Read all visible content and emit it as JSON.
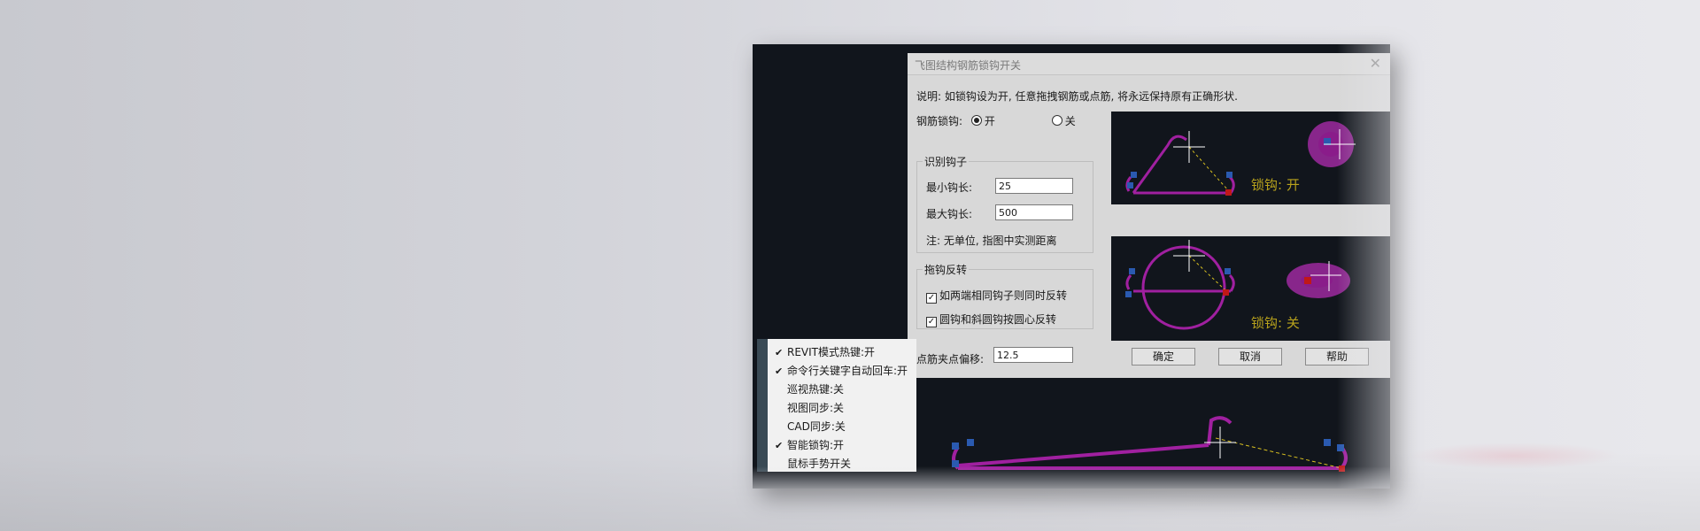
{
  "dialog": {
    "title": "飞图结构钢筋锁钩开关",
    "description": "说明: 如锁钩设为开, 任意拖拽钢筋或点筋, 将永远保持原有正确形状.",
    "lock_label": "钢筋锁钩:",
    "option_on": "开",
    "option_off": "关",
    "identify_group": {
      "title": "识别钩子",
      "min_label": "最小钩长:",
      "min_value": "25",
      "max_label": "最大钩长:",
      "max_value": "500",
      "note": "注: 无单位, 指图中实测距离"
    },
    "flip_group": {
      "title": "拖钩反转",
      "check1": "如两端相同钩子则同时反转",
      "check2": "圆钩和斜圆钩按圆心反转"
    },
    "offset_label": "点筋夹点偏移:",
    "offset_value": "12.5",
    "ok": "确定",
    "cancel": "取消",
    "help": "帮助",
    "preview_on_label": "锁钩: 开",
    "preview_off_label": "锁钩: 关"
  },
  "menu": {
    "items": [
      {
        "checked": "✔",
        "label": "REVIT模式热键:开"
      },
      {
        "checked": "✔",
        "label": "命令行关键字自动回车:开"
      },
      {
        "checked": "",
        "label": "巡视热键:关"
      },
      {
        "checked": "",
        "label": "视图同步:关"
      },
      {
        "checked": "",
        "label": "CAD同步:关"
      },
      {
        "checked": "✔",
        "label": "智能锁钩:开"
      },
      {
        "checked": "",
        "label": "鼠标手势开关"
      }
    ]
  },
  "colors": {
    "rebar": "#a020a0",
    "label_yellow": "#b8a21c",
    "canvas": "#11151c"
  }
}
